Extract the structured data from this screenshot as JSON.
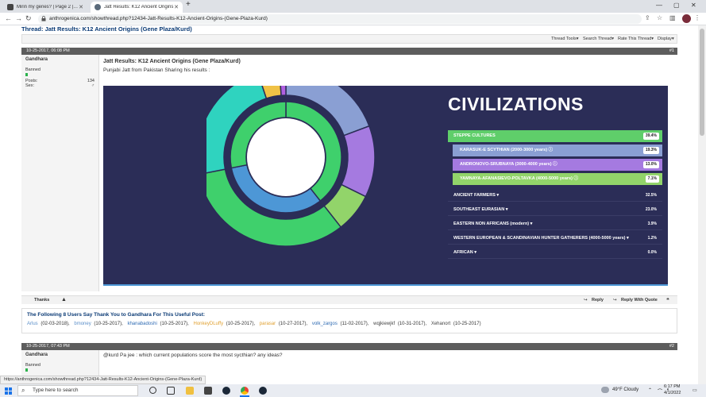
{
  "browser": {
    "tabs": [
      {
        "label": "Mirin my genes? | Page 2 | Looki",
        "color": "#444444",
        "active": false
      },
      {
        "label": "Jatt Results: K12 Ancient Origins",
        "color": "#5a6a7a",
        "active": true
      }
    ],
    "url": "anthrogenica.com/showthread.php?12434-Jatt-Results-K12-Ancient-Origins-(Gene-Plaza-Kurd)",
    "new_tab": "+",
    "minimize": "—",
    "maximize": "▢",
    "close": "✕"
  },
  "page": {
    "thread_title": "Thread: Jatt Results: K12 Ancient Origins (Gene Plaza/Kurd)",
    "thread_tools": [
      "Thread Tools▾",
      "Search Thread▾",
      "Rate This Thread▾",
      "Display▾"
    ]
  },
  "post1": {
    "date": "10-25-2017, 06:08 PM",
    "number": "#1",
    "username": "Gandhara",
    "rank": "Banned",
    "posts_label": "Posts:",
    "posts_value": "134",
    "sex_label": "Sex:",
    "sex_value": "♂",
    "title": "Jatt Results: K12 Ancient Origins (Gene Plaza/Kurd)",
    "text": "Punjabi Jatt from Pakistan Sharing his results :",
    "thanks_label": "Thanks",
    "reply_label": "Reply",
    "reply_quote_label": "Reply With Quote"
  },
  "infographic": {
    "heading": "CIVILIZATIONS",
    "rows": [
      {
        "label": "STEPPE CULTURES",
        "pct": "39.4%",
        "color": "#5fce6a",
        "indent": false
      },
      {
        "label": "KARASUK-E SCYTHIAN (2000-3000 years) ⓘ",
        "pct": "19.3%",
        "color": "#8a9fd3",
        "indent": true
      },
      {
        "label": "ANDRONOVO-SRUBNAYA (3000-4000 years) ⓘ",
        "pct": "13.0%",
        "color": "#a57ae0",
        "indent": true
      },
      {
        "label": "YAMNAYA-AFANASIEVO-POLTAVKA (4000-5000 years) ⓘ",
        "pct": "7.1%",
        "color": "#92d46a",
        "indent": true
      },
      {
        "label": "ANCIENT FARMERS ▾",
        "pct": "32.5%",
        "color": "",
        "indent": false
      },
      {
        "label": "SOUTHEAST EURASIAN ▾",
        "pct": "23.0%",
        "color": "",
        "indent": false
      },
      {
        "label": "EASTERN NON AFRICANS (modern) ▾",
        "pct": "3.9%",
        "color": "",
        "indent": false
      },
      {
        "label": "WESTERN EUROPEAN & SCANDINAVIAN HUNTER GATHERERS (4000-5000 years) ▾",
        "pct": "1.2%",
        "color": "",
        "indent": false
      },
      {
        "label": "AFRICAN ▾",
        "pct": "0.0%",
        "color": "",
        "indent": false
      }
    ],
    "donut_outer": [
      {
        "name": "karasuk",
        "value": 19.3,
        "color": "#8a9fd3"
      },
      {
        "name": "andronovo",
        "value": 13.0,
        "color": "#a57ae0"
      },
      {
        "name": "yamnaya",
        "value": 7.1,
        "color": "#92d46a"
      },
      {
        "name": "farmers",
        "value": 32.5,
        "color": "#3fd06c"
      },
      {
        "name": "southeast",
        "value": 23.0,
        "color": "#2fd3bf"
      },
      {
        "name": "eastern",
        "value": 3.9,
        "color": "#f0c246"
      },
      {
        "name": "west-hg",
        "value": 1.2,
        "color": "#b060e0"
      }
    ],
    "donut_inner": [
      {
        "name": "steppe",
        "value": 39.4,
        "color": "#3fd06c"
      },
      {
        "name": "farmers",
        "value": 32.5,
        "color": "#4d97d6"
      },
      {
        "name": "rest",
        "value": 28.1,
        "color": "#3fd06c"
      }
    ]
  },
  "thanks": {
    "title": "The Following 8 Users Say Thank You to Gandhara For This Useful Post:",
    "users": [
      {
        "name": "Arlus",
        "date": "(02-03-2018)",
        "color": "#5b8fc9"
      },
      {
        "name": "bmoney",
        "date": "(10-25-2017)",
        "color": "#5b8fc9"
      },
      {
        "name": "khanabadoshi",
        "date": "(10-25-2017)",
        "color": "#2f6bb3"
      },
      {
        "name": "HonkeyDLuffy",
        "date": "(10-25-2017)",
        "color": "#e0a030"
      },
      {
        "name": "parasar",
        "date": "(10-27-2017)",
        "color": "#e0a030"
      },
      {
        "name": "volk_zargos",
        "date": "(11-02-2017)",
        "color": "#2f6bb3"
      },
      {
        "name": "wqjkiewjkf",
        "date": "(10-31-2017)",
        "color": "#444444"
      },
      {
        "name": "Xehanort",
        "date": "(10-25-2017)",
        "color": "#444444"
      }
    ]
  },
  "post2": {
    "date": "10-25-2017, 07:43 PM",
    "number": "#2",
    "username": "Gandhara",
    "rank": "Banned",
    "text": "@kurd Pa jee : which current populations score the most sycthian? any ideas?"
  },
  "status_url": "https://anthrogenica.com/showthread.php?12434-Jatt-Results-K12-Ancient-Origins-(Gene-Plaza-Kurd)",
  "taskbar": {
    "search_placeholder": "Type here to search",
    "weather": "49°F Cloudy",
    "time": "6:17 PM",
    "date": "4/1/2022"
  }
}
